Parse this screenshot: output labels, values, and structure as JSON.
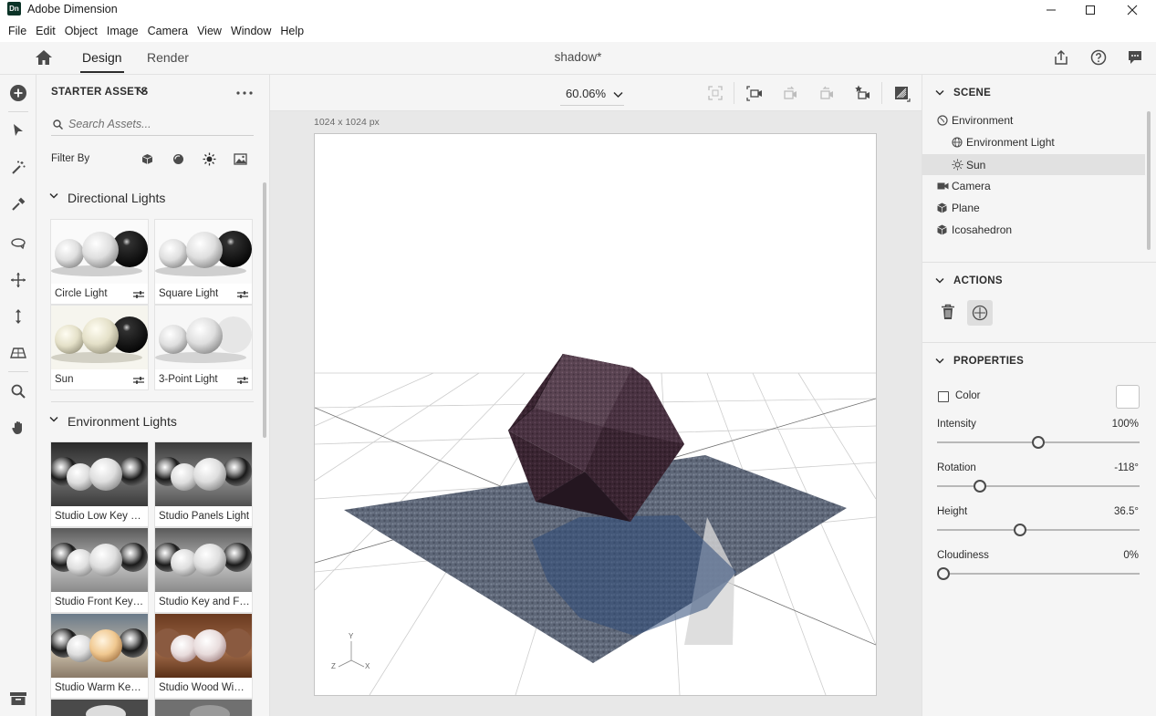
{
  "app": {
    "title": "Adobe Dimension",
    "logo_text": "Dn",
    "document_title": "shadow*"
  },
  "menu": [
    "File",
    "Edit",
    "Object",
    "Image",
    "Camera",
    "View",
    "Window",
    "Help"
  ],
  "tabs": {
    "design": "Design",
    "render": "Render"
  },
  "assets": {
    "header": "STARTER ASSETS",
    "search_placeholder": "Search Assets...",
    "filter_label": "Filter By",
    "sections": [
      {
        "title": "Directional Lights",
        "items": [
          "Circle Light",
          "Square Light",
          "Sun",
          "3-Point Light"
        ]
      },
      {
        "title": "Environment Lights",
        "items": [
          "Studio Low Key Li...",
          "Studio Panels Light",
          "Studio Front Key L...",
          "Studio Key and Fil...",
          "Studio Warm Key ...",
          "Studio Wood Wind..."
        ]
      }
    ]
  },
  "canvas": {
    "zoom": "60.06%",
    "size_label": "1024 x 1024 px",
    "axis": {
      "y": "Y",
      "x": "X",
      "z": "Z"
    }
  },
  "scene": {
    "title": "SCENE",
    "items": [
      {
        "label": "Environment",
        "icon": "environment-icon",
        "level": 0
      },
      {
        "label": "Environment Light",
        "icon": "globe-icon",
        "level": 1
      },
      {
        "label": "Sun",
        "icon": "sun-icon",
        "level": 1,
        "selected": true
      },
      {
        "label": "Camera",
        "icon": "camera-icon",
        "level": 0
      },
      {
        "label": "Plane",
        "icon": "cube-icon",
        "level": 0
      },
      {
        "label": "Icosahedron",
        "icon": "cube-icon",
        "level": 0
      }
    ]
  },
  "actions": {
    "title": "ACTIONS"
  },
  "properties": {
    "title": "PROPERTIES",
    "color_label": "Color",
    "color_value": "#ffffff",
    "sliders": [
      {
        "label": "Intensity",
        "value": "100%",
        "fraction": 0.5
      },
      {
        "label": "Rotation",
        "value": "-118°",
        "fraction": 0.19
      },
      {
        "label": "Height",
        "value": "36.5°",
        "fraction": 0.405
      },
      {
        "label": "Cloudiness",
        "value": "0%",
        "fraction": 0.0
      }
    ]
  },
  "colors": {
    "panel_bg": "#f5f5f5",
    "selected_bg": "#e1e1e1",
    "icosahedron": "#3a2430",
    "plane": "#5f6878"
  }
}
